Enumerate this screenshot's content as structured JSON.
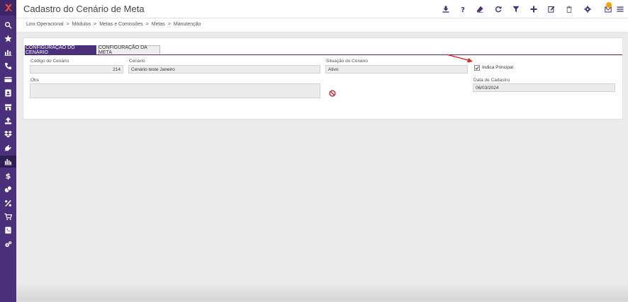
{
  "header": {
    "title": "Cadastro do Cenário de Meta",
    "notification_count": "1"
  },
  "breadcrumb": [
    "Linx Operacional",
    "Módulos",
    "Metas e Comissões",
    "Metas",
    "Manutenção"
  ],
  "tabs": [
    {
      "label": "CONFIGURAÇÃO DO CENÁRIO",
      "active": true
    },
    {
      "label": "CONFIGURAÇÃO DA META",
      "active": false
    }
  ],
  "form": {
    "codigo_label": "Código do Cenário",
    "codigo_value": "214",
    "cenario_label": "Cenário",
    "cenario_value": "Cenário teste Janeiro",
    "situacao_label": "Situação do Cenário",
    "situacao_value": "Ativo",
    "indica_principal_label": "Indica Principal",
    "indica_principal_checked": true,
    "obs_label": "Obs",
    "obs_value": "",
    "data_cadastro_label": "Data de Cadastro",
    "data_cadastro_value": "06/03/2024"
  },
  "colors": {
    "brand": "#4a2f7a",
    "annotation_arrow": "#e02020",
    "forbidden_icon": "#d0202a"
  }
}
